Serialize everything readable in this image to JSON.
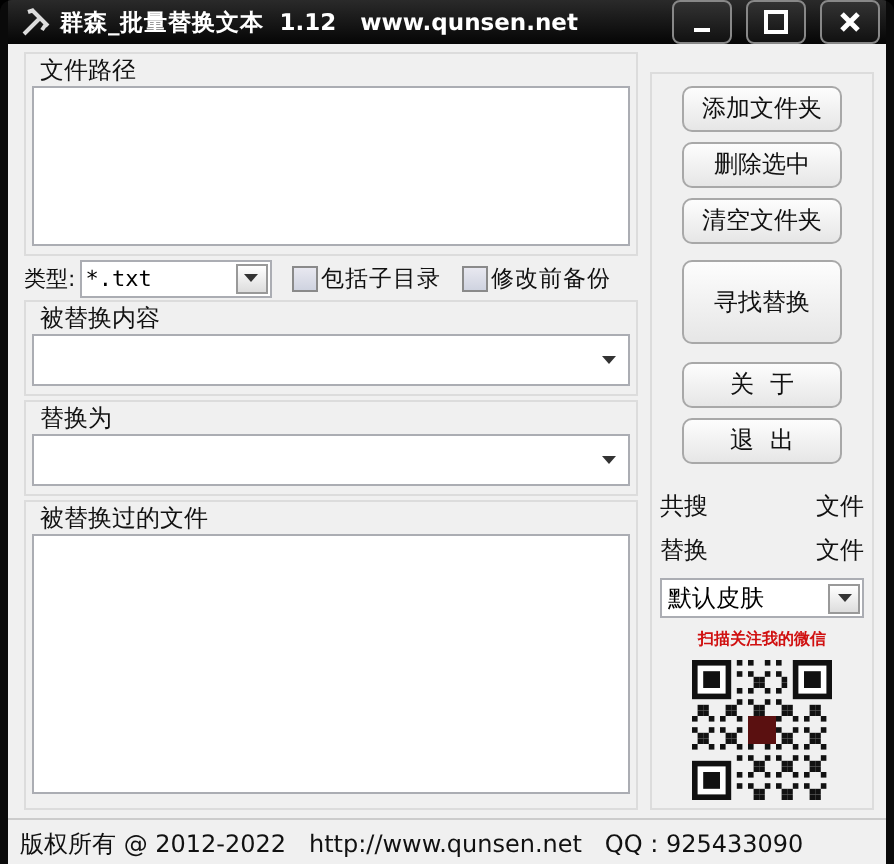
{
  "window": {
    "title": "群森_批量替换文本  1.12   www.qunsen.net"
  },
  "path_group": {
    "label": "文件路径"
  },
  "type_row": {
    "label": "类型:",
    "value": "*.txt",
    "options": [
      {
        "label": "包括子目录",
        "checked": false
      },
      {
        "label": "修改前备份",
        "checked": false
      }
    ]
  },
  "find_group": {
    "label": "被替换内容"
  },
  "replace_group": {
    "label": "替换为"
  },
  "result_group": {
    "label": "被替换过的文件"
  },
  "side_buttons": [
    {
      "label": "添加文件夹",
      "kind": "normal"
    },
    {
      "label": "删除选中",
      "kind": "normal"
    },
    {
      "label": "清空文件夹",
      "kind": "normal"
    },
    {
      "label": "寻找替换",
      "kind": "large"
    },
    {
      "label": "关  于",
      "kind": "normal"
    },
    {
      "label": "退  出",
      "kind": "normal"
    }
  ],
  "stats": [
    {
      "label": "共搜",
      "unit": "文件"
    },
    {
      "label": "替换",
      "unit": "文件"
    }
  ],
  "skin": {
    "value": "默认皮肤"
  },
  "qr_caption": "扫描关注我的微信",
  "status_bar": "版权所有 @ 2012-2022   http://www.qunsen.net   QQ : 925433090"
}
